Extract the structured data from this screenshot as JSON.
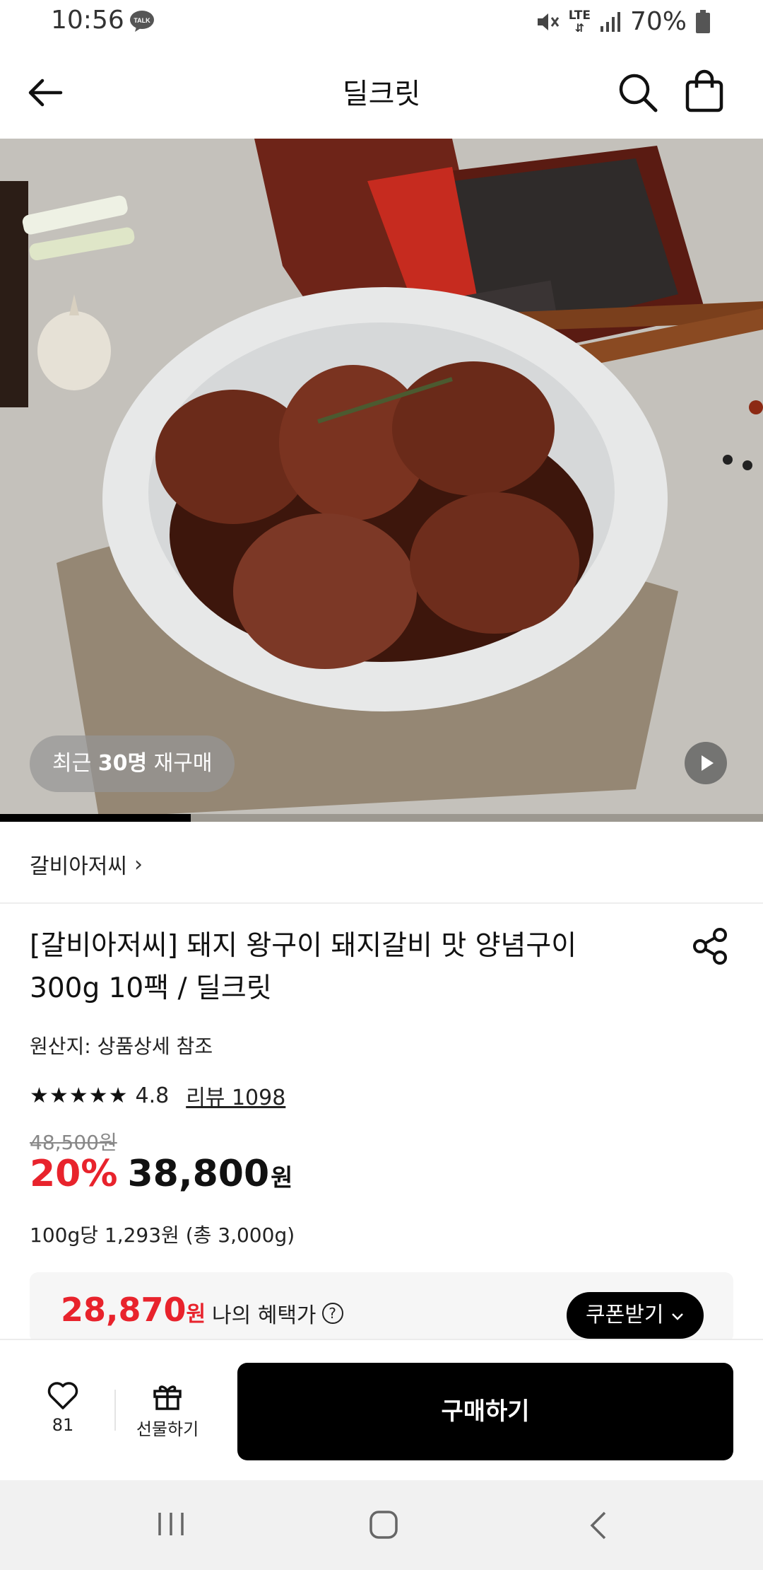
{
  "status_bar": {
    "time": "10:56",
    "talk_badge": "TALK",
    "network": "LTE",
    "battery": "70%",
    "icons": [
      "kakaotalk-icon",
      "mute-icon",
      "lte-icon",
      "signal-icon",
      "battery-icon"
    ]
  },
  "header": {
    "title": "딜크릿",
    "icons": [
      "back-arrow-icon",
      "search-icon",
      "shopping-bag-icon"
    ]
  },
  "hero": {
    "badge_prefix": "최근",
    "badge_count": "30명",
    "badge_suffix": "재구매",
    "carousel_progress": 0.25,
    "icons": [
      "play-icon"
    ]
  },
  "brand": {
    "name": "갈비아저씨",
    "chevron": "›"
  },
  "product": {
    "title": "[갈비아저씨] 돼지 왕구이 돼지갈비 맛 양념구이 300g 10팩 / 딜크릿",
    "origin": "원산지: 상품상세 참조",
    "rating": "4.8",
    "rating_stars": 5,
    "review_link": "리뷰 1098",
    "original_price": "48,500원",
    "discount": "20%",
    "price": "38,800",
    "price_unit": "원",
    "unit_price": "100g당 1,293원 (총 3,000g)"
  },
  "benefit": {
    "price": "28,870",
    "price_unit": "원",
    "label": "나의 혜택가",
    "help": "?",
    "coupon_button": "쿠폰받기"
  },
  "bottom_bar": {
    "like_count": "81",
    "gift_label": "선물하기",
    "buy_label": "구매하기"
  },
  "colors": {
    "accent_red": "#e8232c",
    "black": "#000000",
    "benefit_bg": "#f6f6f6"
  }
}
